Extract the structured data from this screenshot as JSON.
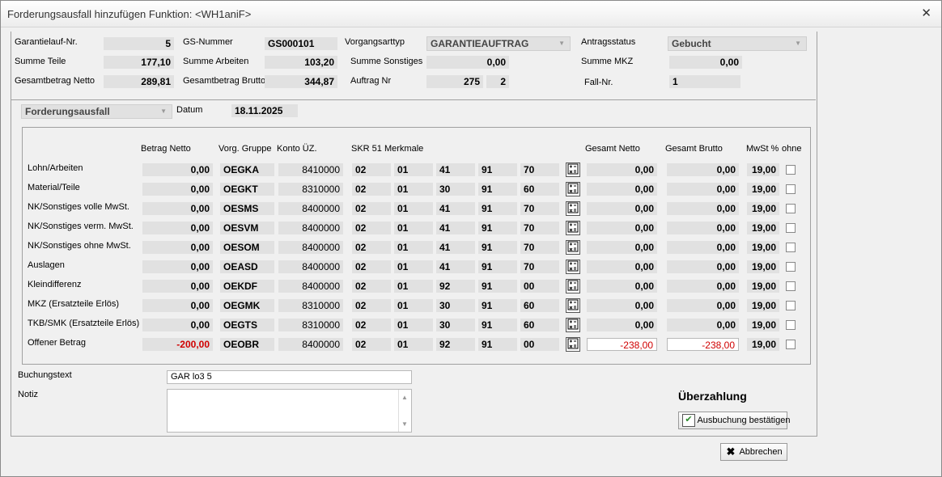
{
  "window": {
    "title": "Forderungsausfall hinzufügen Funktion: <WH1aniF>",
    "close": "✕"
  },
  "header": {
    "garantielauf_label": "Garantielauf-Nr.",
    "garantielauf": "5",
    "gs_label": "GS-Nummer",
    "gs": "GS000101",
    "vorgangsart_label": "Vorgangsarttyp",
    "vorgangsart": "GARANTIEAUFTRAG",
    "antragsstatus_label": "Antragsstatus",
    "antragsstatus": "Gebucht",
    "summe_teile_label": "Summe Teile",
    "summe_teile": "177,10",
    "summe_arbeiten_label": "Summe Arbeiten",
    "summe_arbeiten": "103,20",
    "summe_sonstiges_label": "Summe Sonstiges",
    "summe_sonstiges": "0,00",
    "summe_mkz_label": "Summe MKZ",
    "summe_mkz": "0,00",
    "gesamt_netto_label": "Gesamtbetrag Netto",
    "gesamt_netto": "289,81",
    "gesamt_brutto_label": "Gesamtbetrag Brutto",
    "gesamt_brutto": "344,87",
    "auftrag_label": "Auftrag Nr",
    "auftrag": "275",
    "auftrag_pos": "2",
    "fall_label": "Fall-Nr.",
    "fall": "1"
  },
  "type_select": "Forderungsausfall",
  "datum_label": "Datum",
  "datum": "18.11.2025",
  "columns": {
    "betrag_netto": "Betrag Netto",
    "vorg_gruppe": "Vorg. Gruppe",
    "konto": "Konto ÜZ.",
    "skr": "SKR 51 Merkmale",
    "gesamt_netto": "Gesamt Netto",
    "gesamt_brutto": "Gesamt Brutto",
    "mwst": "MwSt %",
    "ohne": "ohne"
  },
  "rows": [
    {
      "label": "Lohn/Arbeiten",
      "netto": "0,00",
      "gruppe": "OEGKA",
      "konto": "8410000",
      "m1": "02",
      "m2": "01",
      "m3": "41",
      "m4": "91",
      "m5": "70",
      "gnetto": "0,00",
      "gbrutto": "0,00",
      "mwst": "19,00"
    },
    {
      "label": "Material/Teile",
      "netto": "0,00",
      "gruppe": "OEGKT",
      "konto": "8310000",
      "m1": "02",
      "m2": "01",
      "m3": "30",
      "m4": "91",
      "m5": "60",
      "gnetto": "0,00",
      "gbrutto": "0,00",
      "mwst": "19,00"
    },
    {
      "label": "NK/Sonstiges volle MwSt.",
      "netto": "0,00",
      "gruppe": "OESMS",
      "konto": "8400000",
      "m1": "02",
      "m2": "01",
      "m3": "41",
      "m4": "91",
      "m5": "70",
      "gnetto": "0,00",
      "gbrutto": "0,00",
      "mwst": "19,00"
    },
    {
      "label": "NK/Sonstiges verm. MwSt.",
      "netto": "0,00",
      "gruppe": "OESVM",
      "konto": "8400000",
      "m1": "02",
      "m2": "01",
      "m3": "41",
      "m4": "91",
      "m5": "70",
      "gnetto": "0,00",
      "gbrutto": "0,00",
      "mwst": "19,00"
    },
    {
      "label": "NK/Sonstiges ohne MwSt.",
      "netto": "0,00",
      "gruppe": "OESOM",
      "konto": "8400000",
      "m1": "02",
      "m2": "01",
      "m3": "41",
      "m4": "91",
      "m5": "70",
      "gnetto": "0,00",
      "gbrutto": "0,00",
      "mwst": "19,00"
    },
    {
      "label": "Auslagen",
      "netto": "0,00",
      "gruppe": "OEASD",
      "konto": "8400000",
      "m1": "02",
      "m2": "01",
      "m3": "41",
      "m4": "91",
      "m5": "70",
      "gnetto": "0,00",
      "gbrutto": "0,00",
      "mwst": "19,00"
    },
    {
      "label": "Kleindifferenz",
      "netto": "0,00",
      "gruppe": "OEKDF",
      "konto": "8400000",
      "m1": "02",
      "m2": "01",
      "m3": "92",
      "m4": "91",
      "m5": "00",
      "gnetto": "0,00",
      "gbrutto": "0,00",
      "mwst": "19,00"
    },
    {
      "label": "MKZ (Ersatzteile Erlös)",
      "netto": "0,00",
      "gruppe": "OEGMK",
      "konto": "8310000",
      "m1": "02",
      "m2": "01",
      "m3": "30",
      "m4": "91",
      "m5": "60",
      "gnetto": "0,00",
      "gbrutto": "0,00",
      "mwst": "19,00"
    },
    {
      "label": "TKB/SMK (Ersatzteile Erlös)",
      "netto": "0,00",
      "gruppe": "OEGTS",
      "konto": "8310000",
      "m1": "02",
      "m2": "01",
      "m3": "30",
      "m4": "91",
      "m5": "60",
      "gnetto": "0,00",
      "gbrutto": "0,00",
      "mwst": "19,00"
    },
    {
      "label": "Offener Betrag",
      "netto": "-200,00",
      "gruppe": "OEOBR",
      "konto": "8400000",
      "m1": "02",
      "m2": "01",
      "m3": "92",
      "m4": "91",
      "m5": "00",
      "gnetto": "-238,00",
      "gbrutto": "-238,00",
      "mwst": "19,00"
    }
  ],
  "buchungstext_label": "Buchungstext",
  "buchungstext": "GAR lo3  5",
  "notiz_label": "Notiz",
  "ueberzahlung": "Überzahlung",
  "confirm_button": "Ausbuchung bestätigen",
  "cancel_button": "Abbrechen",
  "colors": {
    "red": "#d00000",
    "field": "#e1e1e1"
  }
}
